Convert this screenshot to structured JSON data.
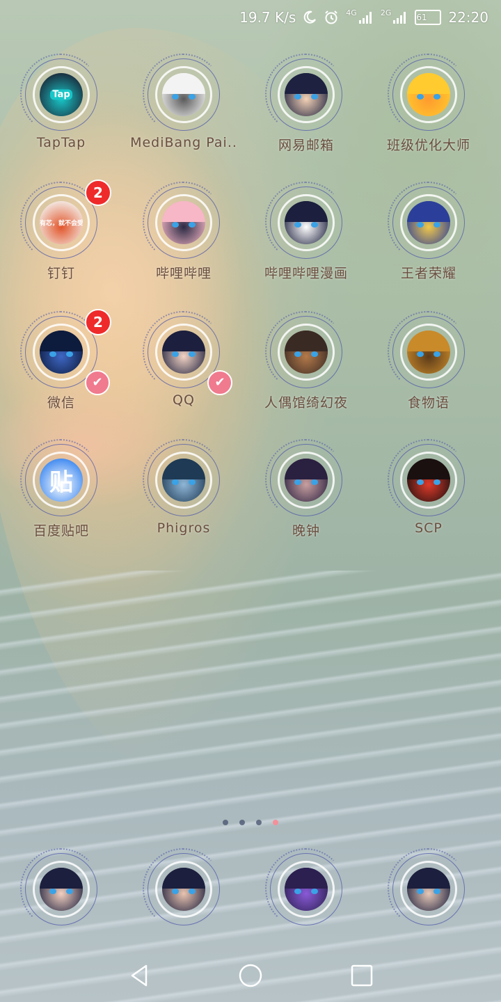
{
  "status_bar": {
    "speed": "19.7 K/s",
    "network_1": "4G",
    "network_2": "2G",
    "battery": "61",
    "time": "22:20"
  },
  "apps": [
    {
      "label": "TapTap",
      "icon": "taptap-icon",
      "icon_text": "Tap",
      "colors": [
        "#1b2a3a",
        "#18c6c8"
      ]
    },
    {
      "label": "MediBang Pai..",
      "icon": "medibang-icon",
      "colors": [
        "#f3f3f3",
        "#5a5a5a"
      ]
    },
    {
      "label": "网易邮箱",
      "icon": "netease-mail-icon",
      "colors": [
        "#1e2240",
        "#f4d2b6"
      ]
    },
    {
      "label": "班级优化大师",
      "icon": "class-master-icon",
      "colors": [
        "#ffcb2f",
        "#ff9a2e"
      ]
    },
    {
      "label": "钉钉",
      "icon": "dingtalk-icon",
      "badge": "2",
      "icon_text": "有芯，就不会受",
      "colors": [
        "#f3ece6",
        "#e2552b"
      ]
    },
    {
      "label": "哔哩哔哩",
      "icon": "bilibili-icon",
      "colors": [
        "#f7b7c6",
        "#2a2a44"
      ]
    },
    {
      "label": "哔哩哔哩漫画",
      "icon": "bilibili-comics-icon",
      "colors": [
        "#1c1f3d",
        "#ffffff"
      ]
    },
    {
      "label": "王者荣耀",
      "icon": "honor-of-kings-icon",
      "colors": [
        "#2b3f9a",
        "#f1c84a"
      ]
    },
    {
      "label": "微信",
      "icon": "wechat-icon",
      "badge": "2",
      "shield": true,
      "colors": [
        "#0d1b3d",
        "#3e67c4"
      ]
    },
    {
      "label": "QQ",
      "icon": "qq-icon",
      "shield": true,
      "colors": [
        "#1c1f3d",
        "#f3d4c4"
      ]
    },
    {
      "label": "人偶馆绮幻夜",
      "icon": "doll-house-icon",
      "colors": [
        "#3a2a24",
        "#b47a4a"
      ]
    },
    {
      "label": "食物语",
      "icon": "food-fantasy-icon",
      "colors": [
        "#c98a2a",
        "#5a3a1a"
      ]
    },
    {
      "label": "百度贴吧",
      "icon": "baidu-tieba-icon",
      "icon_text": "贴",
      "colors": [
        "#3b87f0",
        "#ffffff"
      ]
    },
    {
      "label": "Phigros",
      "icon": "phigros-icon",
      "colors": [
        "#1e3a55",
        "#8fb6d6"
      ]
    },
    {
      "label": "晚钟",
      "icon": "evening-bell-icon",
      "colors": [
        "#2a2040",
        "#c8a0a0"
      ]
    },
    {
      "label": "SCP",
      "icon": "scp-icon",
      "colors": [
        "#1a1010",
        "#e03a2a"
      ]
    }
  ],
  "dock": [
    {
      "icon": "dock-app-1-icon",
      "colors": [
        "#1c1f3d",
        "#f2d0c0"
      ]
    },
    {
      "icon": "dock-app-2-icon",
      "colors": [
        "#1c1f3d",
        "#e9c4b0"
      ]
    },
    {
      "icon": "dock-app-3-icon",
      "colors": [
        "#2b2050",
        "#8a5ad8"
      ]
    },
    {
      "icon": "dock-app-4-icon",
      "colors": [
        "#1c1f3d",
        "#e6c9b8"
      ]
    }
  ],
  "pager": {
    "total": 4,
    "active": 4
  },
  "nav": {
    "back": "back-icon",
    "home": "home-icon",
    "recents": "recents-icon"
  }
}
